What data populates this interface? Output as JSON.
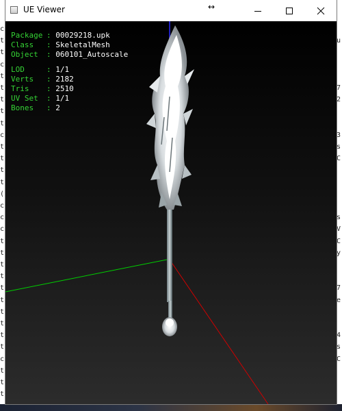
{
  "window": {
    "title": "UE Viewer",
    "icon": "app-icon",
    "controls": {
      "minimize_icon": "minimize-icon",
      "maximize_icon": "maximize-icon",
      "close_icon": "close-icon"
    },
    "resize_cursor": "↔"
  },
  "info": {
    "object_block": [
      {
        "label": "Package",
        "sep": ":",
        "value": "00029218.upk"
      },
      {
        "label": "Class",
        "sep": ":",
        "value": "SkeletalMesh"
      },
      {
        "label": "Object",
        "sep": ":",
        "value": "060101_Autoscale"
      }
    ],
    "stats_block": [
      {
        "label": "LOD",
        "sep": ":",
        "value": "1/1"
      },
      {
        "label": "Verts",
        "sep": ":",
        "value": "2182"
      },
      {
        "label": "Tris",
        "sep": ":",
        "value": "2510"
      },
      {
        "label": "UV Set",
        "sep": ":",
        "value": "1/1"
      },
      {
        "label": "Bones",
        "sep": ":",
        "value": "2"
      }
    ],
    "label_color": "#35d435",
    "value_color": "#ffffff"
  },
  "scene": {
    "axis_colors": {
      "x": "#00d000",
      "y": "#d00000",
      "z": "#2020c0"
    }
  },
  "background": {
    "left_glyphs": [
      "c",
      "t",
      "t",
      "c",
      "t",
      "t",
      "t",
      "t",
      "t",
      "c",
      "t",
      "t",
      "t",
      "t",
      "(",
      "c",
      "c",
      "c",
      "t",
      "t",
      "t",
      "t",
      "t",
      "t",
      "t",
      "t",
      "t",
      "t",
      "c",
      "t",
      "t",
      "t"
    ],
    "right_glyphs": [
      "",
      "u",
      "",
      "",
      "",
      "7",
      "2",
      "",
      "",
      "3",
      "s",
      "C",
      "",
      "",
      "",
      "",
      "s",
      "V",
      "C",
      "y",
      "",
      "",
      "7",
      "e",
      "",
      "",
      "4",
      "s",
      "C",
      "",
      ""
    ]
  }
}
